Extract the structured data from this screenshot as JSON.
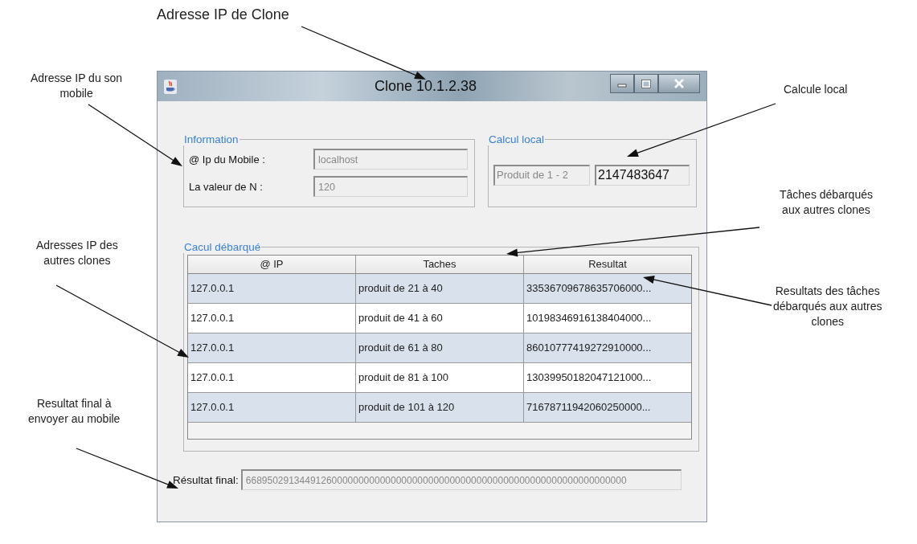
{
  "annotations": [
    {
      "text": "Adresse IP de Clone"
    },
    {
      "text": "Adresse IP du son\nmobile"
    },
    {
      "text": "Calcule local"
    },
    {
      "text": "Tâches débarqués\naux autres  clones"
    },
    {
      "text": "Adresses IP des\nautres clones"
    },
    {
      "text": "Resultats des tâches\ndébarqués aux autres\nclones"
    },
    {
      "text": "Resultat final à\nenvoyer au mobile"
    }
  ],
  "window": {
    "title": "Clone  10.1.2.38"
  },
  "information": {
    "title": "Information",
    "fields": [
      {
        "label": "@ Ip du Mobile :",
        "value": "localhost"
      },
      {
        "label": "La valeur de N :",
        "value": "120"
      }
    ]
  },
  "local_calc": {
    "title": "Calcul local",
    "label_value": "Produit de 1 - 2",
    "result": "2147483647"
  },
  "offloaded": {
    "title": "Cacul débarqué",
    "columns": [
      "@ IP",
      "Taches",
      "Resultat"
    ],
    "rows": [
      [
        "127.0.0.1",
        "produit de 21 à 40",
        "33536709678635706000..."
      ],
      [
        "127.0.0.1",
        "produit de 41 à 60",
        "10198346916138404000..."
      ],
      [
        "127.0.0.1",
        "produit de 61 à 80",
        "86010777419272910000..."
      ],
      [
        "127.0.0.1",
        "produit de 81 à 100",
        "13039950182047121000..."
      ],
      [
        "127.0.0.1",
        "produit de 101 à 120",
        "71678711942060250000..."
      ]
    ]
  },
  "final": {
    "label": "Résultat final:",
    "value": "66895029134491260000000000000000000000000000000000000000000000000000000"
  }
}
